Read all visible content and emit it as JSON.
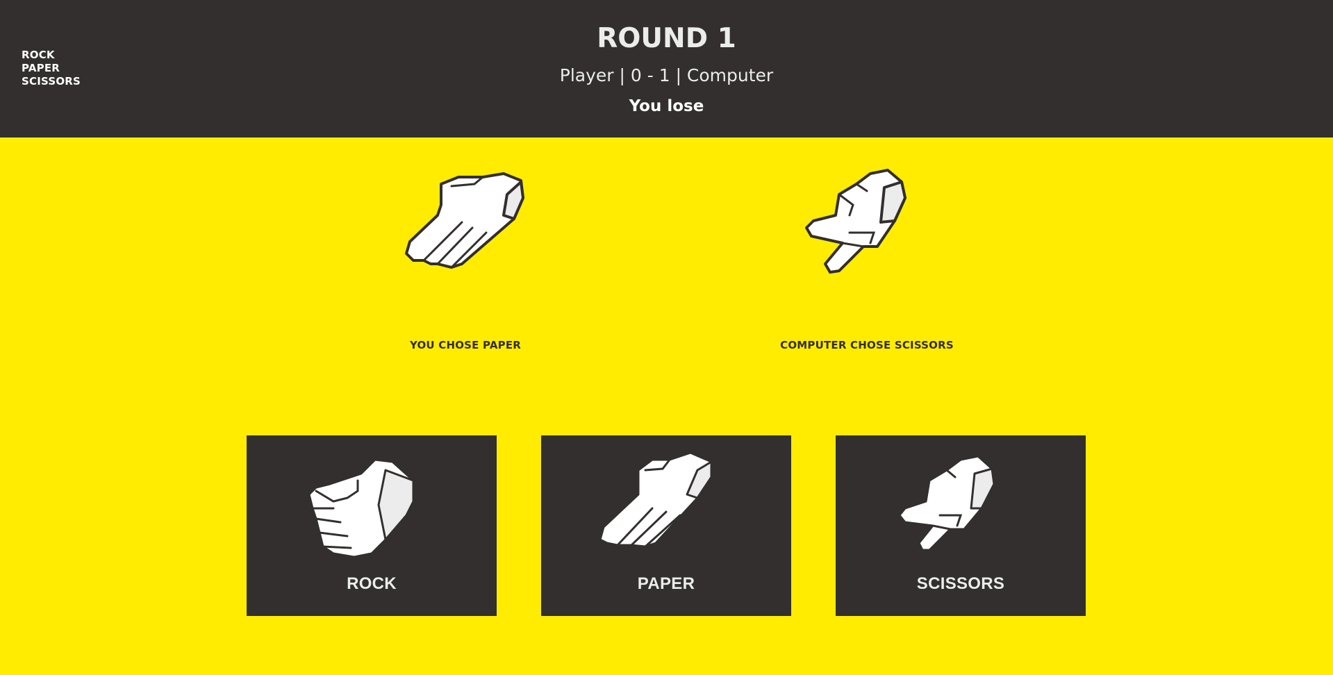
{
  "header": {
    "logo_lines": [
      "ROCK",
      "PAPER",
      "SCISSORS"
    ],
    "round_title": "ROUND 1",
    "score_line": "Player | 0 - 1 | Computer",
    "result": "You lose"
  },
  "choices": {
    "player": {
      "caption": "YOU CHOSE PAPER",
      "icon": "paper-hand-icon"
    },
    "computer": {
      "caption": "COMPUTER CHOSE SCISSORS",
      "icon": "scissors-hand-icon"
    }
  },
  "buttons": [
    {
      "label": "ROCK",
      "icon": "rock-fist-icon"
    },
    {
      "label": "PAPER",
      "icon": "paper-hand-icon"
    },
    {
      "label": "SCISSORS",
      "icon": "scissors-hand-icon"
    }
  ],
  "colors": {
    "background": "#ffec00",
    "panel": "#322f2e",
    "text_light": "#ececec",
    "hand_fill": "#ffffff",
    "hand_shade": "#ececec"
  }
}
